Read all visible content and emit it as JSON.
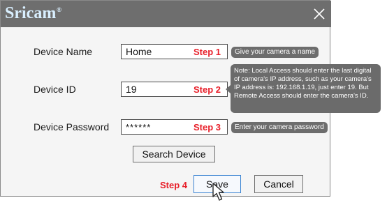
{
  "title_bar": {
    "brand": "Sricam",
    "brand_mark": "®",
    "close_icon": "close-icon"
  },
  "form": {
    "device_name": {
      "label": "Device Name",
      "value": "Home",
      "step": "Step 1",
      "hint": "Give your camera a name"
    },
    "device_id": {
      "label": "Device ID",
      "value": "19",
      "step": "Step 2"
    },
    "device_password": {
      "label": "Device Password",
      "value": "******",
      "step": "Step 3",
      "hint": "Enter your camera password"
    }
  },
  "note": {
    "lines": [
      "Note:  Local Access should enter the last digital",
      "of camera's IP address, such as your camera's",
      "IP address is: 192.168.1.19, just enter 19. But",
      "Remote Access should enter the camera's ID."
    ]
  },
  "buttons": {
    "search": "Search Device",
    "step4": "Step 4",
    "save": "Save",
    "cancel": "Cancel"
  },
  "colors": {
    "titlebar": "#6e6e6e",
    "brand": "#d9efff",
    "step_red": "#e8202a",
    "hint_bg": "#6d6d6d",
    "dialog_bg": "#f5f5f5"
  },
  "icons": {
    "cursor": "mouse-pointer-icon"
  }
}
